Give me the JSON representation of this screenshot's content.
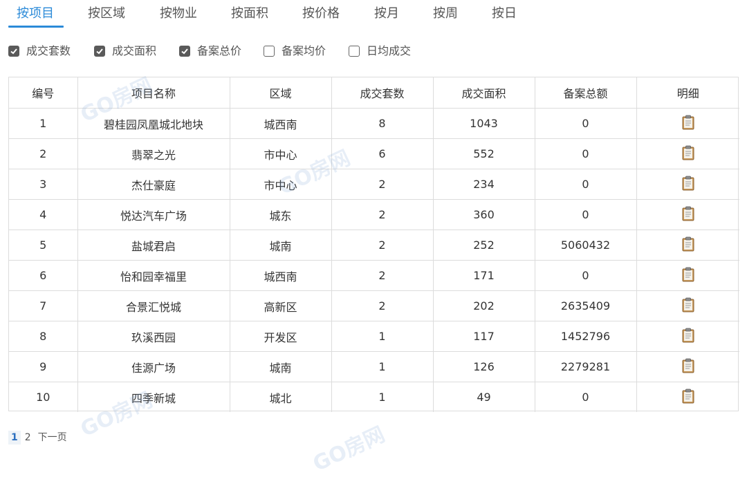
{
  "tabs": [
    {
      "label": "按项目",
      "active": true
    },
    {
      "label": "按区域"
    },
    {
      "label": "按物业"
    },
    {
      "label": "按面积"
    },
    {
      "label": "按价格"
    },
    {
      "label": "按月"
    },
    {
      "label": "按周"
    },
    {
      "label": "按日"
    }
  ],
  "checks": [
    {
      "label": "成交套数",
      "checked": true
    },
    {
      "label": "成交面积",
      "checked": true
    },
    {
      "label": "备案总价",
      "checked": true
    },
    {
      "label": "备案均价",
      "checked": false
    },
    {
      "label": "日均成交",
      "checked": false
    }
  ],
  "table": {
    "headers": [
      "编号",
      "项目名称",
      "区域",
      "成交套数",
      "成交面积",
      "备案总额",
      "明细"
    ],
    "rows": [
      [
        "1",
        "碧桂园凤凰城北地块",
        "城西南",
        "8",
        "1043",
        "0"
      ],
      [
        "2",
        "翡翠之光",
        "市中心",
        "6",
        "552",
        "0"
      ],
      [
        "3",
        "杰仕豪庭",
        "市中心",
        "2",
        "234",
        "0"
      ],
      [
        "4",
        "悦达汽车广场",
        "城东",
        "2",
        "360",
        "0"
      ],
      [
        "5",
        "盐城君启",
        "城南",
        "2",
        "252",
        "5060432"
      ],
      [
        "6",
        "怡和园幸福里",
        "城西南",
        "2",
        "171",
        "0"
      ],
      [
        "7",
        "合景汇悦城",
        "高新区",
        "2",
        "202",
        "2635409"
      ],
      [
        "8",
        "玖溪西园",
        "开发区",
        "1",
        "117",
        "1452796"
      ],
      [
        "9",
        "佳源广场",
        "城南",
        "1",
        "126",
        "2279281"
      ],
      [
        "10",
        "四季新城",
        "城北",
        "1",
        "49",
        "0"
      ]
    ]
  },
  "pager": {
    "pages": [
      "1",
      "2"
    ],
    "current": "1",
    "next_label": "下一页"
  },
  "watermark": "GO房网",
  "colors": {
    "accent": "#2b8ad8"
  }
}
